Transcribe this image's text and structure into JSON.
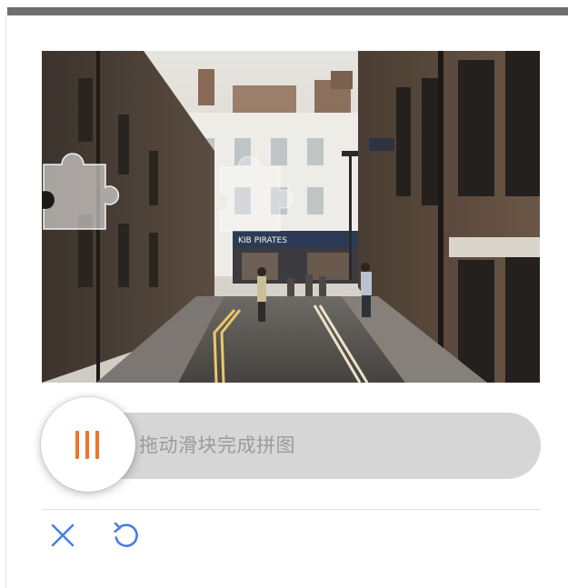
{
  "captcha": {
    "slider_hint": "拖动滑块完成拼图",
    "accent_color": "#f07427",
    "action_color": "#4a7fe3",
    "image_subject": "street-scene-with-puzzle-piece"
  },
  "toolbar": {
    "close_icon": "close-icon",
    "refresh_icon": "refresh-icon"
  },
  "storefront_sign": {
    "text": "KIB PIRATES"
  }
}
